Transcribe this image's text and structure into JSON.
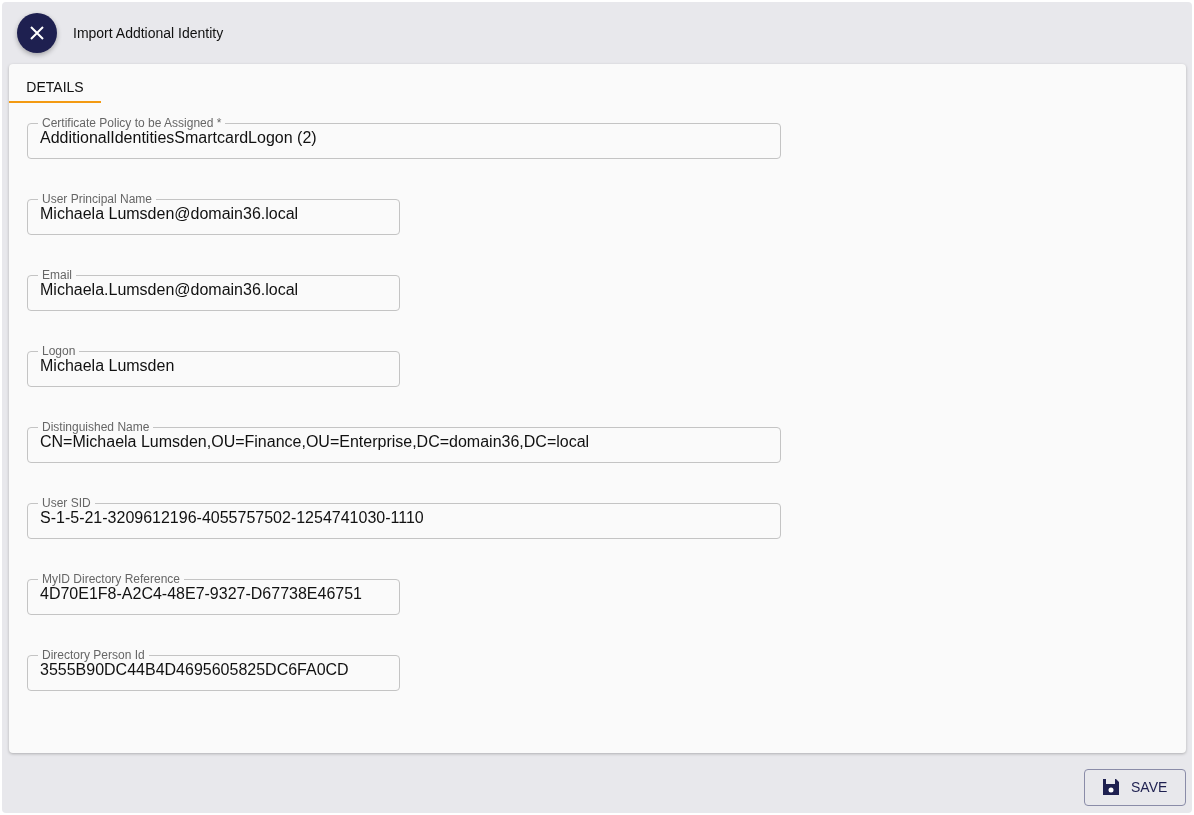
{
  "header": {
    "title": "Import Addtional Identity"
  },
  "tabs": [
    {
      "label": "DETAILS",
      "selected": true
    }
  ],
  "fields": [
    {
      "label": "Certificate Policy to be Assigned *",
      "value": "AdditionalIdentitiesSmartcardLogon (2)",
      "kind": "wide"
    },
    {
      "label": "User Principal Name",
      "value": "Michaela Lumsden@domain36.local",
      "kind": "narrow"
    },
    {
      "label": "Email",
      "value": "Michaela.Lumsden@domain36.local",
      "kind": "narrow"
    },
    {
      "label": "Logon",
      "value": "Michaela Lumsden",
      "kind": "narrow"
    },
    {
      "label": "Distinguished Name",
      "value": "CN=Michaela Lumsden,OU=Finance,OU=Enterprise,DC=domain36,DC=local",
      "kind": "wide"
    },
    {
      "label": "User SID",
      "value": "S-1-5-21-3209612196-4055757502-1254741030-1110",
      "kind": "wide"
    },
    {
      "label": "MyID Directory Reference",
      "value": "4D70E1F8-A2C4-48E7-9327-D67738E46751",
      "kind": "narrow"
    },
    {
      "label": "Directory Person Id",
      "value": "3555B90DC44B4D4695605825DC6FA0CD",
      "kind": "narrow"
    }
  ],
  "footer": {
    "save_button": "SAVE"
  }
}
